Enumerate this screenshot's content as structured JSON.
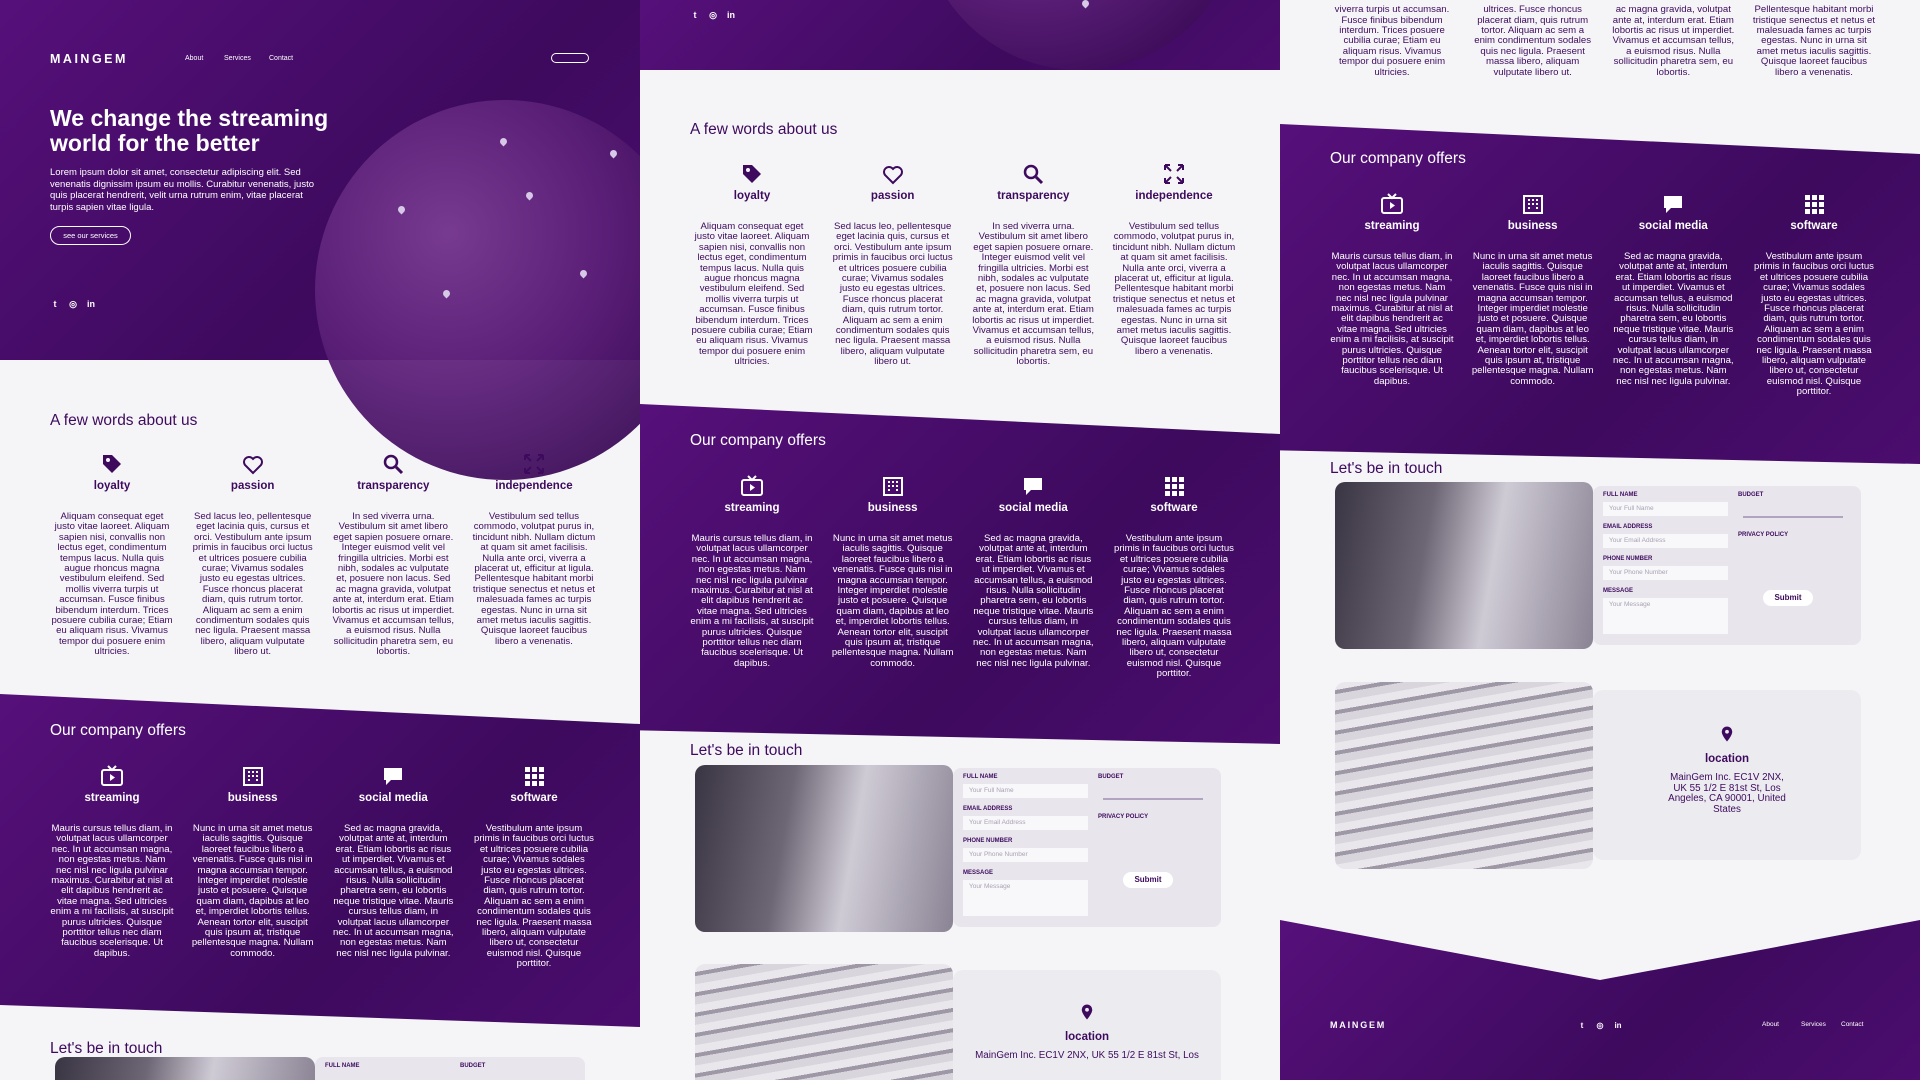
{
  "brand": "MAINGEM",
  "nav": {
    "about": "About",
    "services": "Services",
    "contact": "Contact"
  },
  "hero": {
    "title": "We change the streaming world for the better",
    "text": "Lorem ipsum dolor sit amet, consectetur adipiscing elit. Sed venenatis dignissim ipsum eu mollis. Curabitur venenatis, justo quis placerat hendrerit, velit urna rutrum enim, vitae placerat turpis sapien vitae ligula.",
    "cta": "see our services"
  },
  "social_icons": [
    "twitter-icon",
    "instagram-icon",
    "linkedin-icon"
  ],
  "about": {
    "heading": "A few words about us",
    "items": [
      {
        "icon": "tag-icon",
        "title": "loyalty",
        "text": "Aliquam consequat eget justo vitae laoreet. Aliquam sapien nisi, convallis non lectus eget, condimentum tempus lacus. Nulla quis augue rhoncus magna vestibulum eleifend. Sed mollis viverra turpis ut accumsan. Fusce finibus bibendum interdum. Trices posuere cubilia curae; Etiam eu aliquam risus. Vivamus tempor dui posuere enim ultricies."
      },
      {
        "icon": "heart-icon",
        "title": "passion",
        "text": "Sed lacus leo, pellentesque eget lacinia quis, cursus et orci. Vestibulum ante ipsum primis in faucibus orci luctus et ultrices posuere cubilia curae; Vivamus sodales justo eu egestas ultrices. Fusce rhoncus placerat diam, quis rutrum tortor. Aliquam ac sem a enim condimentum sodales quis nec ligula. Praesent massa libero, aliquam vulputate libero ut."
      },
      {
        "icon": "search-icon",
        "title": "transparency",
        "text": "In sed viverra urna. Vestibulum sit amet libero eget sapien posuere ornare. Integer euismod velit vel fringilla ultricies. Morbi est nibh, sodales ac vulputate et, posuere non lacus. Sed ac magna gravida, volutpat ante at, interdum erat. Etiam lobortis ac risus ut imperdiet. Vivamus et accumsan tellus, a euismod risus. Nulla sollicitudin pharetra sem, eu lobortis."
      },
      {
        "icon": "expand-icon",
        "title": "independence",
        "text": "Vestibulum sed tellus commodo, volutpat purus in, tincidunt nibh. Nullam dictum at quam sit amet facilisis. Nulla ante orci, viverra a placerat ut, efficitur at ligula. Pellentesque habitant morbi tristique senectus et netus et malesuada fames ac turpis egestas. Nunc in urna sit amet metus iaculis sagittis. Quisque laoreet faucibus libero a venenatis."
      }
    ]
  },
  "offers": {
    "heading": "Our company offers",
    "items": [
      {
        "icon": "tv-icon",
        "title": "streaming",
        "text": "Mauris cursus tellus diam, in volutpat lacus ullamcorper nec. In ut accumsan magna, non egestas metus. Nam nec nisl nec ligula pulvinar maximus. Curabitur at nisl at elit dapibus hendrerit ac vitae magna. Sed ultricies enim a mi facilisis, at suscipit purus ultricies. Quisque porttitor tellus nec diam faucibus scelerisque. Ut dapibus."
      },
      {
        "icon": "building-icon",
        "title": "business",
        "text": "Nunc in urna sit amet metus iaculis sagittis. Quisque laoreet faucibus libero a venenatis. Fusce quis nisi in magna accumsan tempor. Integer imperdiet molestie justo et posuere. Quisque quam diam, dapibus at leo et, imperdiet lobortis tellus. Aenean tortor elit, suscipit quis ipsum at, tristique pellentesque magna. Nullam commodo."
      },
      {
        "icon": "chat-icon",
        "title": "social media",
        "text": "Sed ac magna gravida, volutpat ante at, interdum erat. Etiam lobortis ac risus ut imperdiet. Vivamus et accumsan tellus, a euismod risus. Nulla sollicitudin pharetra sem, eu lobortis neque tristique vitae. Mauris cursus tellus diam, in volutpat lacus ullamcorper nec. In ut accumsan magna, non egestas metus. Nam nec nisl nec ligula pulvinar."
      },
      {
        "icon": "grid-icon",
        "title": "software",
        "text": "Vestibulum ante ipsum primis in faucibus orci luctus et ultrices posuere cubilia curae; Vivamus sodales justo eu egestas ultrices. Fusce rhoncus placerat diam, quis rutrum tortor. Aliquam ac sem a enim condimentum sodales quis nec ligula. Praesent massa libero, aliquam vulputate libero ut, consectetur euismod nisl. Quisque porttitor."
      }
    ]
  },
  "contact": {
    "heading": "Let's be in touch",
    "labels": {
      "full_name": "FULL NAME",
      "email": "EMAIL ADDRESS",
      "phone": "PHONE NUMBER",
      "message": "MESSAGE",
      "budget": "BUDGET",
      "privacy": "PRIVACY POLICY"
    },
    "placeholders": {
      "full_name": "Your Full Name",
      "email": "Your Email Address",
      "phone": "Your Phone Number",
      "message": "Your Message"
    },
    "submit": "Submit"
  },
  "location": {
    "title": "location",
    "address": "MainGem Inc. EC1V 2NX, UK 55 1/2 E 81st St, Los Angeles, CA 90001, United States",
    "address_partial": "MainGem Inc. EC1V 2NX, UK 55 1/2 E 81st St, Los"
  },
  "colors": {
    "primary": "#4b0d6e",
    "dark": "#3d0a5e",
    "light_bg": "#f5f5f7"
  }
}
